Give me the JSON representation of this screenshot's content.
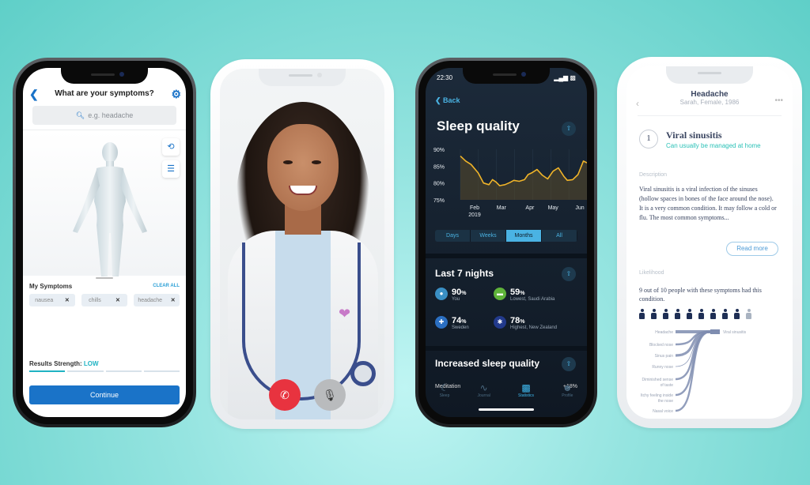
{
  "background_color": "#7fdcd6",
  "phone1": {
    "title": "What are your symptoms?",
    "back_icon": "chevron-left",
    "settings_icon": "gear",
    "search_placeholder": "e.g. headache",
    "rotate_icon": "rotate",
    "list_icon": "list",
    "my_symptoms_label": "My Symptoms",
    "clear_all_label": "CLEAR ALL",
    "symptoms": [
      {
        "label": "nausea"
      },
      {
        "label": "chills"
      },
      {
        "label": "headache"
      }
    ],
    "results_strength_label": "Results Strength:",
    "results_strength_value": "LOW",
    "results_strength_level": 1,
    "results_strength_max": 4,
    "continue_label": "Continue",
    "accent": "#1a73c8"
  },
  "phone2": {
    "end_call_icon": "phone-hangup",
    "mute_icon": "microphone-off",
    "end_call_color": "#e8333f"
  },
  "phone3": {
    "status_time": "22:30",
    "back_label": "Back",
    "title": "Sleep quality",
    "share_icon": "share",
    "segments": [
      {
        "label": "Days",
        "active": false
      },
      {
        "label": "Weeks",
        "active": false
      },
      {
        "label": "Months",
        "active": true
      },
      {
        "label": "All",
        "active": false
      }
    ],
    "last7_title": "Last 7 nights",
    "stats": [
      {
        "icon": "user",
        "value": "90",
        "unit": "%",
        "label": "You",
        "color": "#3a8fc4"
      },
      {
        "icon": "saudi-flag",
        "value": "59",
        "unit": "%",
        "label": "Lowest, Saudi Arabia",
        "color": "#5fb33a"
      },
      {
        "icon": "sweden-flag",
        "value": "74",
        "unit": "%",
        "label": "Sweden",
        "color": "#2b6fc2"
      },
      {
        "icon": "new-zealand-flag",
        "value": "78",
        "unit": "%",
        "label": "Highest, New Zealand",
        "color": "#223a8c"
      }
    ],
    "increased_title": "Increased sleep quality",
    "meditation_label": "Meditation",
    "meditation_value": "+18%",
    "tabs": [
      {
        "label": "Sleep",
        "icon": "moon",
        "active": false
      },
      {
        "label": "Journal",
        "icon": "pulse",
        "active": false
      },
      {
        "label": "Statistics",
        "icon": "bar-chart",
        "active": true
      },
      {
        "label": "Profile",
        "icon": "person",
        "active": false
      }
    ]
  },
  "chart_data": {
    "type": "area",
    "title": "Sleep quality",
    "xlabel": "",
    "ylabel": "",
    "x_ticks": [
      "Feb\n2019",
      "Mar",
      "Apr",
      "May",
      "Jun"
    ],
    "y_ticks": [
      "90%",
      "85%",
      "80%",
      "75%"
    ],
    "ylim": [
      75,
      90
    ],
    "grid": true,
    "series": [
      {
        "name": "Sleep quality",
        "color": "#f0b429",
        "x": [
          0,
          0.3,
          0.6,
          1.0,
          1.3,
          1.6,
          1.8,
          2.0,
          2.2,
          2.5,
          2.8,
          3.0,
          3.3,
          3.6,
          3.8,
          4.0,
          4.3,
          4.6,
          4.9,
          5.2,
          5.5,
          5.8,
          6.0,
          6.3,
          6.6,
          6.9,
          7.1
        ],
        "y": [
          88,
          86.5,
          85.5,
          83,
          80,
          79.5,
          81,
          80.3,
          79.2,
          79.5,
          80.2,
          80.8,
          80.5,
          81,
          82.5,
          83,
          84,
          82.3,
          81.2,
          83.5,
          84.5,
          82,
          80.8,
          81,
          82.5,
          86.5,
          86
        ]
      }
    ]
  },
  "phone4": {
    "title": "Headache",
    "subtitle": "Sarah, Female, 1986",
    "rank": "1",
    "condition": "Viral sinusitis",
    "condition_sub": "Can usually be managed at home",
    "description_label": "Description",
    "description": "Viral sinusitis is a viral infection of the sinuses (hollow spaces in bones of the face around the nose). It is a very common condition. It may follow a cold or flu. The most common symptoms...",
    "read_more_label": "Read more",
    "likelihood_label": "Likelihood",
    "likelihood_text": "9 out of 10 people with these symptoms had this condition.",
    "likelihood_numerator": 9,
    "likelihood_denominator": 10,
    "sankey_target": "Viral sinusitis",
    "sankey_sources": [
      {
        "label": "Headache",
        "weight": 5
      },
      {
        "label": "Blocked nose",
        "weight": 3
      },
      {
        "label": "Sinus pain",
        "weight": 4
      },
      {
        "label": "Runny nose",
        "weight": 1
      },
      {
        "label": "Diminished sense of taste",
        "weight": 3
      },
      {
        "label": "Itchy feeling inside the nose",
        "weight": 3
      },
      {
        "label": "Nasal voice",
        "weight": 3
      }
    ],
    "accent": "#2bc1b7"
  }
}
